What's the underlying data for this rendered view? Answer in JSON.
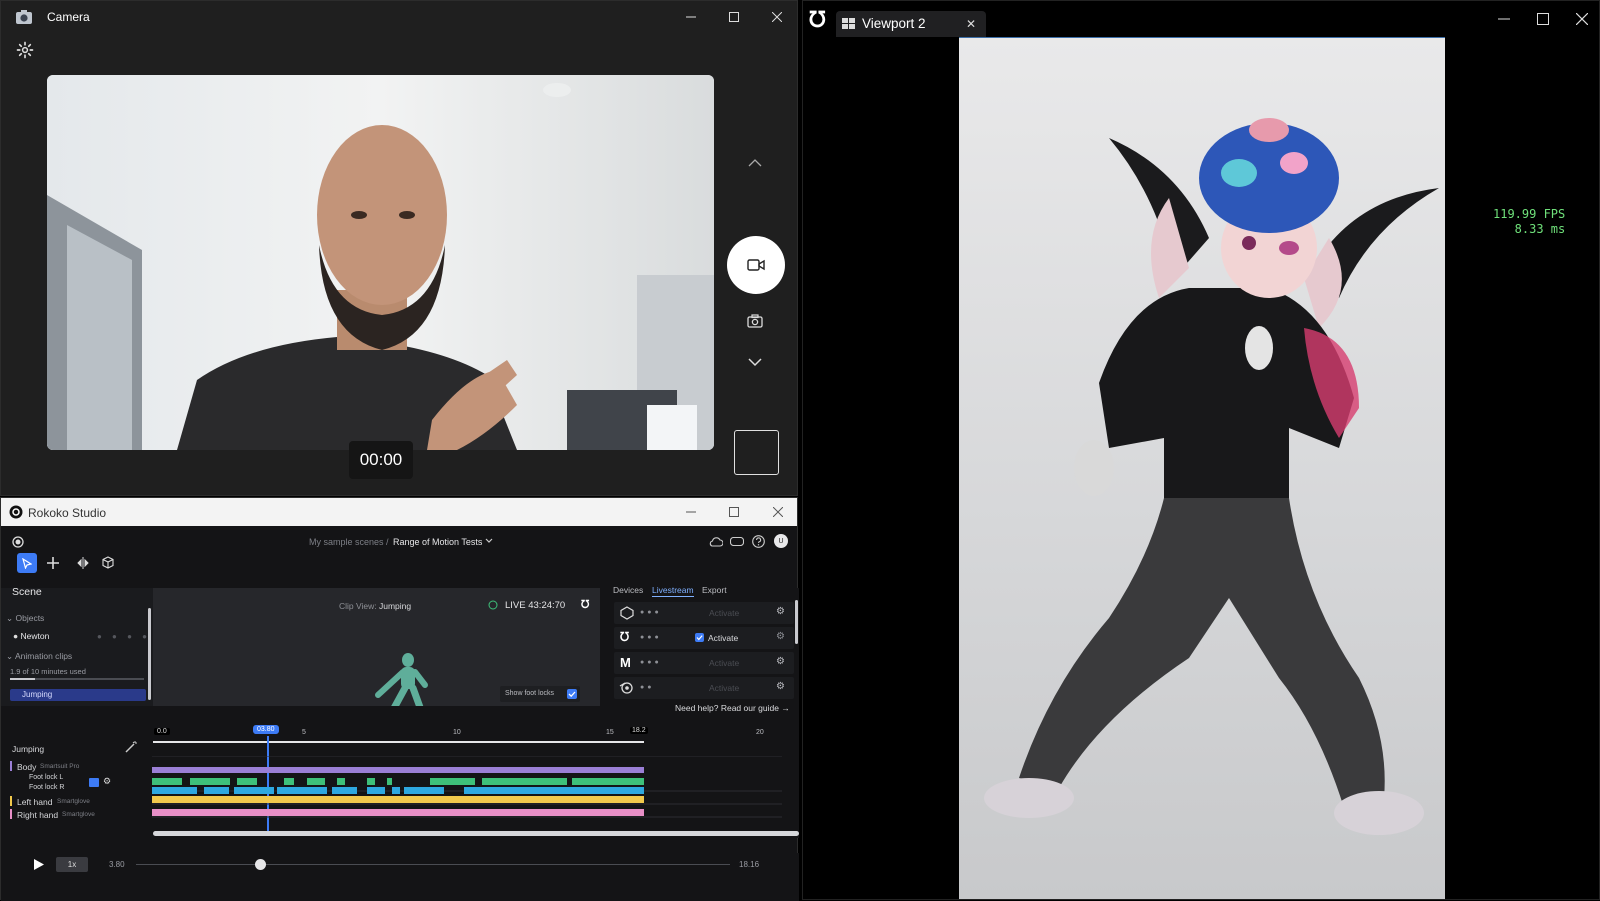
{
  "camera": {
    "title": "Camera",
    "timer": "00:00"
  },
  "rokoko": {
    "title": "Rokoko Studio",
    "breadcrumb_parent": "My sample scenes /",
    "breadcrumb_current": "Range of Motion Tests",
    "avatar": "U",
    "scene": {
      "title": "Scene",
      "objects_label": "Objects",
      "object_name": "Newton",
      "clips_label": "Animation clips",
      "usage": "1.9 of 10 minutes used",
      "clip_name": "Jumping"
    },
    "clip_view": {
      "prefix": "Clip View:",
      "clip": "Jumping",
      "live": "LIVE 43:24:70",
      "show_foot_locks": "Show foot locks"
    },
    "live_panel": {
      "tabs": [
        "Devices",
        "Livestream",
        "Export"
      ],
      "activate": "Activate",
      "help": "Need help? Read our guide →"
    },
    "timeline": {
      "clip_label": "Jumping",
      "ticks": [
        "0.0",
        "5",
        "10",
        "15",
        "18.2",
        "20"
      ],
      "playhead": "03.80",
      "tracks": [
        {
          "name": "Body",
          "device": "Smartsuit Pro"
        },
        {
          "name": "Foot lock L",
          "device": ""
        },
        {
          "name": "Foot lock R",
          "device": ""
        },
        {
          "name": "Left hand",
          "device": "Smartglove"
        },
        {
          "name": "Right hand",
          "device": "Smartglove"
        }
      ]
    },
    "playbar": {
      "speed": "1x",
      "current": "3.80",
      "end": "18.16",
      "progress": 0.21
    }
  },
  "viewport": {
    "tab": "Viewport 2",
    "fps": "119.99 FPS",
    "ms": "8.33 ms"
  },
  "colors": {
    "accent": "#3d7bf5",
    "timeline_body": "#9b7fd6",
    "timeline_green": "#3ec07a",
    "timeline_blue": "#2ea8e0",
    "timeline_yellow": "#f2c94c",
    "timeline_pink": "#e88fc7",
    "fps_text": "#6fe07a"
  }
}
